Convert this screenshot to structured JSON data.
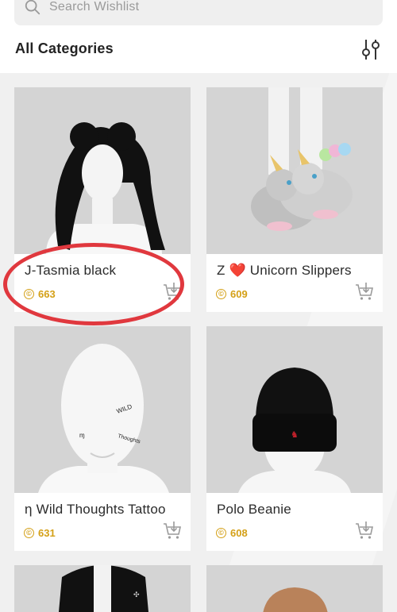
{
  "search": {
    "placeholder": "Search Wishlist",
    "icon": "search-icon"
  },
  "header": {
    "title": "All Categories",
    "filter_icon": "filter-sliders-icon"
  },
  "items": [
    {
      "name": "J-Tasmia black",
      "price": "663",
      "currency_symbol": "©"
    },
    {
      "name": "Z ❤️ Unicorn Slippers",
      "price": "609",
      "currency_symbol": "©"
    },
    {
      "name": "η Wild Thoughts Tattoo",
      "price": "631",
      "currency_symbol": "©"
    },
    {
      "name": "Polo Beanie",
      "price": "608",
      "currency_symbol": "©"
    }
  ],
  "colors": {
    "price": "#d4a017",
    "annotation": "#e0383e",
    "heart": "#d81f26"
  }
}
